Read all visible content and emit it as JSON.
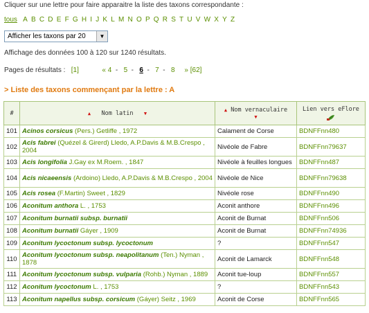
{
  "instruction": "Cliquer sur une lettre pour faire apparaitre la liste des taxons correspondante :",
  "letters": {
    "all_label": "tous",
    "items": [
      "A",
      "B",
      "C",
      "D",
      "E",
      "F",
      "G",
      "H",
      "I",
      "J",
      "K",
      "L",
      "M",
      "N",
      "O",
      "P",
      "Q",
      "R",
      "S",
      "T",
      "U",
      "V",
      "W",
      "X",
      "Y",
      "Z"
    ]
  },
  "per_page": {
    "selected": "Afficher les taxons par 20"
  },
  "status": "Affichage des données 100 à 120 sur 1240 résultats.",
  "pager": {
    "label": "Pages de résultats :",
    "first": "[1]",
    "prev": "«",
    "pages": [
      "4",
      "5",
      "6",
      "7",
      "8"
    ],
    "current": "6",
    "next": "»",
    "last": "[62]"
  },
  "heading": "> Liste des taxons commençant par la lettre : A",
  "table": {
    "headers": {
      "num": "#",
      "latin": "Nom latin",
      "vernacular": "Nom vernaculaire",
      "link": "Lien vers eFlore"
    },
    "rows": [
      {
        "num": "101",
        "species": "Acinos corsicus",
        "infra": "",
        "author": "(Pers.) Getliffe , 1972",
        "vernacular": "Calament de Corse",
        "link": "BDNFFnn480"
      },
      {
        "num": "102",
        "species": "Acis fabrei",
        "infra": "",
        "author": "(Quézel & Girerd) Lledo, A.P.Davis & M.B.Crespo , 2004",
        "vernacular": "Nivéole de Fabre",
        "link": "BDNFFnn79637"
      },
      {
        "num": "103",
        "species": "Acis longifolia",
        "infra": "",
        "author": "J.Gay ex M.Roem. , 1847",
        "vernacular": "Nivéole à feuilles longues",
        "link": "BDNFFnn487"
      },
      {
        "num": "104",
        "species": "Acis nicaeensis",
        "infra": "",
        "author": "(Ardoino) Lledo, A.P.Davis & M.B.Crespo , 2004",
        "vernacular": "Nivéole de Nice",
        "link": "BDNFFnn79638"
      },
      {
        "num": "105",
        "species": "Acis rosea",
        "infra": "",
        "author": "(F.Martin) Sweet , 1829",
        "vernacular": "Nivéole rose",
        "link": "BDNFFnn490"
      },
      {
        "num": "106",
        "species": "Aconitum anthora",
        "infra": "",
        "author": "L. , 1753",
        "vernacular": "Aconit anthore",
        "link": "BDNFFnn496"
      },
      {
        "num": "107",
        "species": "Aconitum burnatii",
        "infra": "subsp. burnatii",
        "author": "",
        "vernacular": "Aconit de Burnat",
        "link": "BDNFFnn506"
      },
      {
        "num": "108",
        "species": "Aconitum burnatii",
        "infra": "",
        "author": "Gáyer , 1909",
        "vernacular": "Aconit de Burnat",
        "link": "BDNFFnn74936"
      },
      {
        "num": "109",
        "species": "Aconitum lycoctonum",
        "infra": "subsp. lycoctonum",
        "author": "",
        "vernacular": "?",
        "link": "BDNFFnn547"
      },
      {
        "num": "110",
        "species": "Aconitum lycoctonum",
        "infra": "subsp. neapolitanum",
        "author": "(Ten.) Nyman , 1878",
        "vernacular": "Aconit de Lamarck",
        "link": "BDNFFnn548"
      },
      {
        "num": "111",
        "species": "Aconitum lycoctonum",
        "infra": "subsp. vulparia",
        "author": "(Rohb.) Nyman , 1889",
        "vernacular": "Aconit tue-loup",
        "link": "BDNFFnn557"
      },
      {
        "num": "112",
        "species": "Aconitum lycoctonum",
        "infra": "",
        "author": "L. , 1753",
        "vernacular": "?",
        "link": "BDNFFnn543"
      },
      {
        "num": "113",
        "species": "Aconitum napellus",
        "infra": "subsp. corsicum",
        "author": "(Gáyer) Seitz , 1969",
        "vernacular": "Aconit de Corse",
        "link": "BDNFFnn565"
      }
    ]
  },
  "colors": {
    "link_green": "#5b8f00",
    "heading_orange": "#e07a10",
    "header_bg": "#f0f5e6",
    "border_green": "#a8c47a"
  }
}
